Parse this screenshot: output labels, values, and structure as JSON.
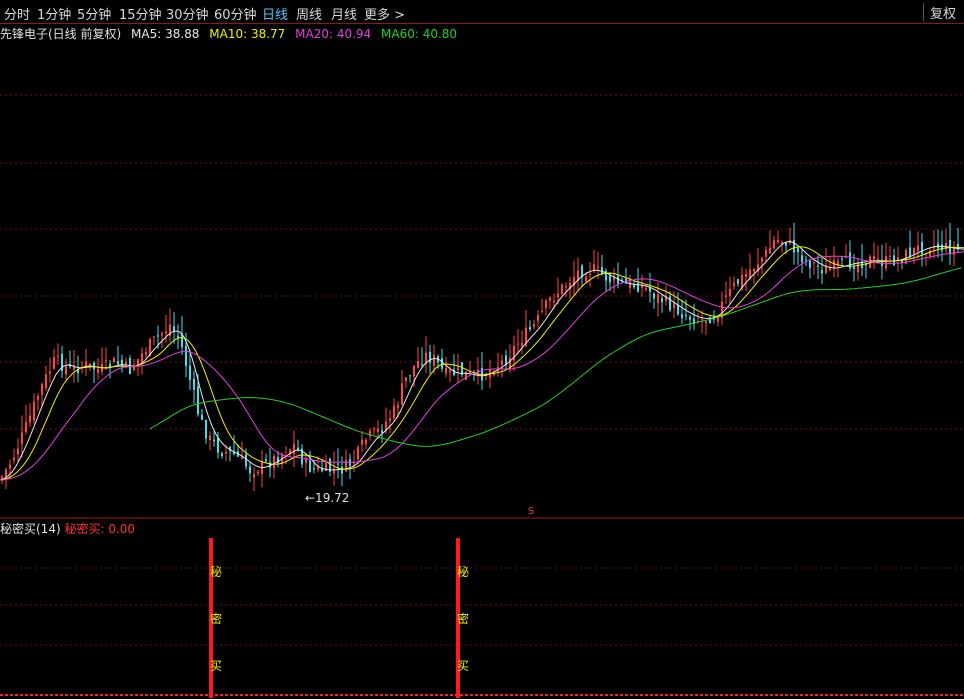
{
  "toolbar": {
    "tabs": [
      {
        "label": "分时",
        "active": false
      },
      {
        "label": "1分钟",
        "active": false
      },
      {
        "label": "5分钟",
        "active": false
      },
      {
        "label": "15分钟",
        "active": false
      },
      {
        "label": "30分钟",
        "active": false
      },
      {
        "label": "60分钟",
        "active": false
      },
      {
        "label": "日线",
        "active": true
      },
      {
        "label": "周线",
        "active": false
      },
      {
        "label": "月线",
        "active": false
      },
      {
        "label": "更多 >",
        "active": false
      }
    ],
    "fuquan_label": "复权"
  },
  "info": {
    "title": "先锋电子(日线 前复权)",
    "ma5": "MA5: 38.88",
    "ma10": "MA10: 38.77",
    "ma20": "MA20: 40.94",
    "ma60": "MA60: 40.80"
  },
  "low_label": "←19.72",
  "marker_label": "S",
  "indicator": {
    "name": "秘密买(14)",
    "value": "秘密买: 0.00",
    "signal_chars": [
      "秘",
      "密",
      "买"
    ]
  },
  "colors": {
    "up": "#ff4545",
    "down": "#40e0f0",
    "ma5": "#e8e8e8",
    "ma10": "#f0f000",
    "ma20": "#e040e0",
    "ma60": "#20d020",
    "grid": "#7a1010",
    "signal": "#ff1a1a",
    "text_yellow": "#f0f000"
  }
}
